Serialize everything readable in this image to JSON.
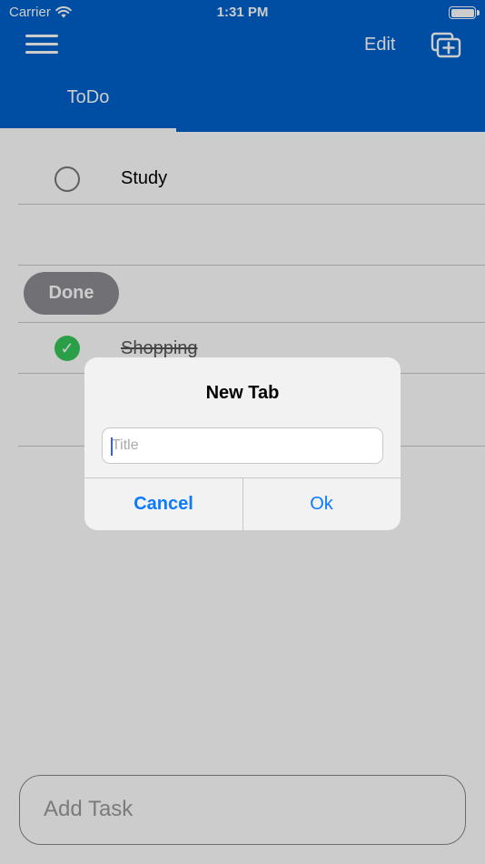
{
  "status_bar": {
    "carrier": "Carrier",
    "time": "1:31 PM"
  },
  "header": {
    "edit_label": "Edit",
    "tabs": [
      {
        "label": "ToDo",
        "selected": true
      }
    ],
    "color": "#0062cc"
  },
  "tasks": {
    "todo": [
      {
        "label": "Study",
        "completed": false
      }
    ],
    "done_label": "Done",
    "done": [
      {
        "label": "Shopping",
        "completed": true
      }
    ]
  },
  "add_task": {
    "placeholder": "Add Task"
  },
  "alert": {
    "title": "New Tab",
    "input_placeholder": "Title",
    "input_value": "",
    "cancel_label": "Cancel",
    "ok_label": "Ok"
  },
  "colors": {
    "accent": "#0a7aff",
    "check": "#35c759",
    "done_pill": "#8e8e93"
  }
}
